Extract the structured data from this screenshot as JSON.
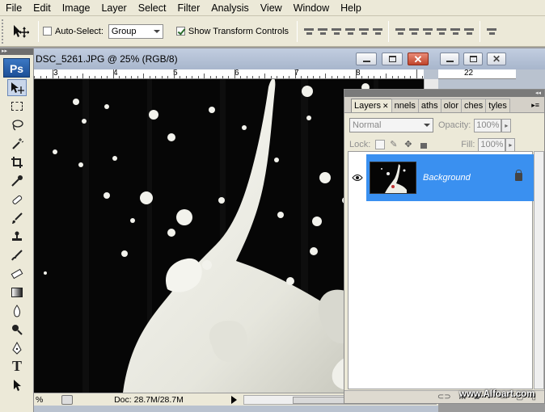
{
  "menu": [
    "File",
    "Edit",
    "Image",
    "Layer",
    "Select",
    "Filter",
    "Analysis",
    "View",
    "Window",
    "Help"
  ],
  "options": {
    "auto_select_label": "Auto-Select:",
    "auto_select_checked": false,
    "auto_select_value": "Group",
    "show_transform_label": "Show Transform Controls",
    "show_transform_checked": true
  },
  "toolbox": {
    "logo": "Ps",
    "tools": [
      "move-tool",
      "marquee-tool",
      "lasso-tool",
      "magic-wand-tool",
      "crop-tool",
      "eyedropper-tool",
      "healing-brush-tool",
      "brush-tool",
      "clone-stamp-tool",
      "history-brush-tool",
      "eraser-tool",
      "gradient-tool",
      "blur-tool",
      "dodge-tool",
      "pen-tool",
      "type-tool",
      "path-selection-tool"
    ]
  },
  "document": {
    "title": "DSC_5261.JPG @ 25% (RGB/8)",
    "ruler_numbers": [
      "3",
      "4",
      "5",
      "6",
      "7",
      "8"
    ],
    "doc_size": "Doc: 28.7M/28.7M",
    "zoom": "%"
  },
  "second_window": {
    "ruler_number": "22"
  },
  "layers_panel": {
    "tabs": [
      {
        "label": "Layers",
        "active": true
      },
      {
        "label": "nnels",
        "active": false
      },
      {
        "label": "aths",
        "active": false
      },
      {
        "label": "olor",
        "active": false
      },
      {
        "label": "ches",
        "active": false
      },
      {
        "label": "tyles",
        "active": false
      }
    ],
    "blend_mode": "Normal",
    "opacity_label": "Opacity:",
    "opacity_value": "100%",
    "lock_label": "Lock:",
    "fill_label": "Fill:",
    "fill_value": "100%",
    "layer": {
      "name": "Background"
    },
    "bottom_icons": [
      "link-icon",
      "fx",
      "mask-icon",
      "adjustment-icon",
      "folder-icon"
    ]
  },
  "watermark": "www.Alfoart.com",
  "colors": {
    "selection": "#3a90f0",
    "chrome": "#ece9d8"
  }
}
